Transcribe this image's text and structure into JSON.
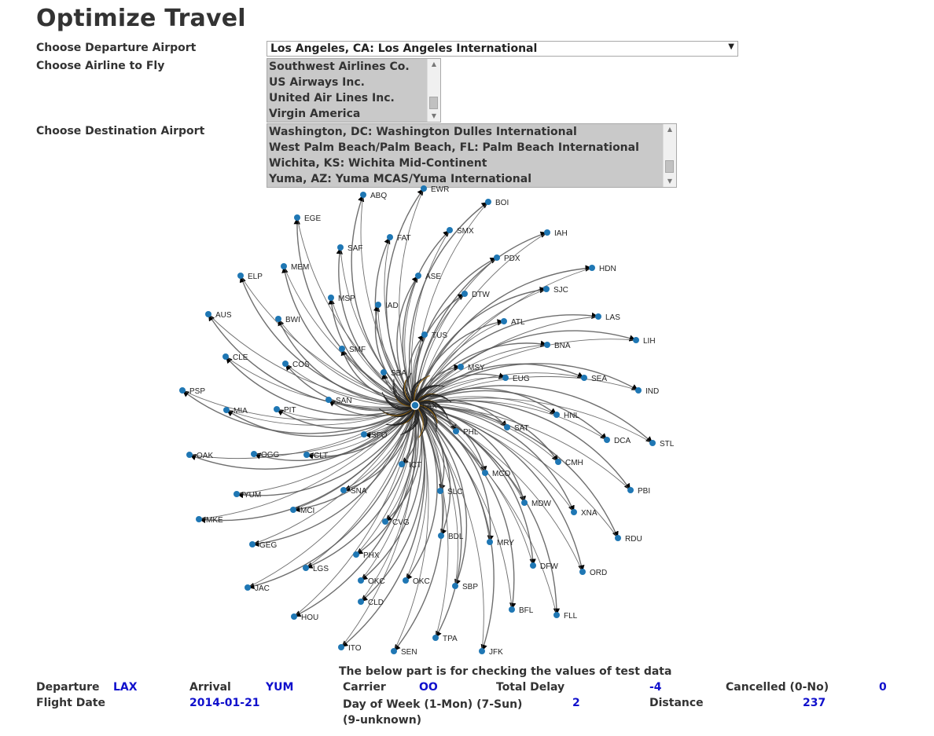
{
  "page": {
    "title": "Optimize Travel",
    "departure_label": "Choose Departure Airport",
    "airline_label": "Choose Airline to Fly",
    "destination_label": "Choose Destination Airport"
  },
  "departure": {
    "selected": "Los Angeles, CA: Los Angeles International"
  },
  "airlines": [
    "Southwest Airlines Co.",
    "US Airways Inc.",
    "United Air Lines Inc.",
    "Virgin America"
  ],
  "destinations": [
    "Washington, DC: Washington Dulles International",
    "West Palm Beach/Palm Beach, FL: Palm Beach International",
    "Wichita, KS: Wichita Mid-Continent",
    "Yuma, AZ: Yuma MCAS/Yuma International"
  ],
  "graph": {
    "center_label": "LAX",
    "node_color": "#1f77b4",
    "link_color": "#555555",
    "nodes": [
      "EWR",
      "ABQ",
      "BOI",
      "EGE",
      "IAH",
      "FAT",
      "SMX",
      "SAF",
      "PDX",
      "HDN",
      "MEM",
      "ELP",
      "ASE",
      "SJC",
      "MSP",
      "DTW",
      "IAD",
      "AUS",
      "BWI",
      "LAS",
      "ATL",
      "LIH",
      "TUS",
      "BNA",
      "SMF",
      "CLE",
      "COS",
      "MSY",
      "SBA",
      "SEA",
      "EUG",
      "IND",
      "PSP",
      "PIT",
      "SAN",
      "HNL",
      "MIA",
      "SFO",
      "PHL",
      "DCA",
      "SAT",
      "STL",
      "OAK",
      "OGG",
      "CLT",
      "ICT",
      "CMH",
      "MCO",
      "YUM",
      "SNA",
      "SLC",
      "PBI",
      "MDW",
      "MCI",
      "XNA",
      "MKE",
      "CVG",
      "RDU",
      "BDL",
      "MRY",
      "GEG",
      "PHX",
      "LGS",
      "DFW",
      "ORD",
      "JAC",
      "SMF2",
      "SBP",
      "OKC",
      "BFL",
      "CLD",
      "HOU",
      "FLL",
      "SEN",
      "ITO",
      "TPA",
      "JFK"
    ]
  },
  "test_values": {
    "note": "The below part is for checking the values of test data",
    "departure_label": "Departure",
    "departure_value": "LAX",
    "arrival_label": "Arrival",
    "arrival_value": "YUM",
    "carrier_label": "Carrier",
    "carrier_value": "OO",
    "total_delay_label": "Total Delay",
    "total_delay_value": "-4",
    "cancelled_label": "Cancelled (0-No)",
    "cancelled_value": "0",
    "flight_date_label": "Flight Date",
    "flight_date_value": "2014-01-21",
    "day_of_week_label": "Day of Week (1-Mon) (7-Sun) (9-unknown)",
    "day_of_week_value": "2",
    "distance_label": "Distance",
    "distance_value": "237"
  }
}
